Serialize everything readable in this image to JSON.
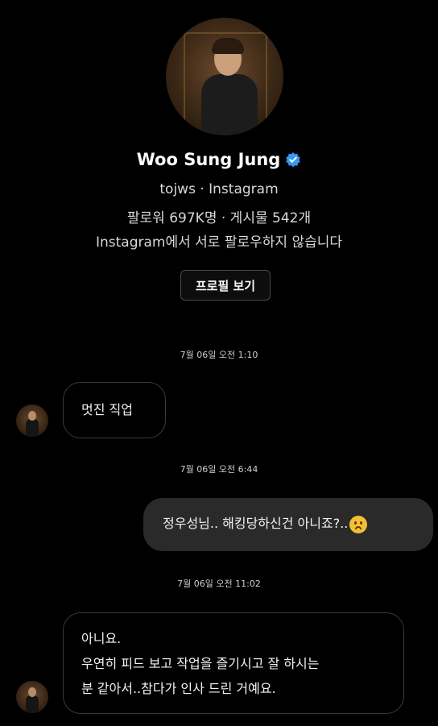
{
  "profile": {
    "name": "Woo Sung Jung",
    "handle_line": "tojws · Instagram",
    "stats_line": "팔로워 697K명 · 게시물 542개",
    "follow_line": "Instagram에서 서로 팔로우하지 않습니다",
    "view_profile_label": "프로필 보기",
    "verified_color": "#3897f0"
  },
  "messages": [
    {
      "timestamp": "7월 06일 오전 1:10",
      "direction": "incoming",
      "lines": [
        "멋진 직업"
      ]
    },
    {
      "timestamp": "7월 06일 오전 6:44",
      "direction": "outgoing",
      "lines": [
        "정우성님.. 해킹당하신건 아니죠?.."
      ],
      "emoji": "worried-face"
    },
    {
      "timestamp": "7월 06일 오전 11:02",
      "direction": "incoming",
      "lines": [
        "아니요.",
        "우연히 피드 보고 작업을 즐기시고 잘 하시는",
        "분 같아서..참다가 인사 드린 거예요."
      ]
    }
  ]
}
